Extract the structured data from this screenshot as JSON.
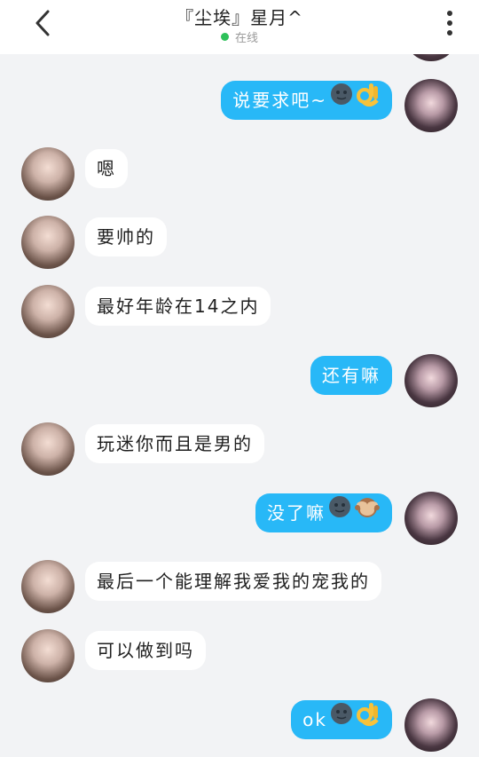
{
  "header": {
    "title": "『尘埃』星月^",
    "status": "在线",
    "status_color": "#2ec15a",
    "back_icon": "chevron-left-icon",
    "menu_icon": "more-vertical-icon"
  },
  "colors": {
    "background": "#f2f3f5",
    "incoming_bubble": "#ffffff",
    "outgoing_bubble": "#28b8f7"
  },
  "messages": [
    {
      "side": "out",
      "text": "说要求吧~",
      "emojis": [
        "new-moon-face-emoji",
        "ok-hand-emoji"
      ]
    },
    {
      "side": "in",
      "text": "嗯"
    },
    {
      "side": "in",
      "text": "要帅的"
    },
    {
      "side": "in",
      "text": "最好年龄在14之内"
    },
    {
      "side": "out",
      "text": "还有嘛"
    },
    {
      "side": "in",
      "text": "玩迷你而且是男的"
    },
    {
      "side": "out",
      "text": "没了嘛",
      "emojis": [
        "new-moon-face-emoji",
        "see-no-evil-monkey-emoji"
      ]
    },
    {
      "side": "in",
      "text": "最后一个能理解我爱我的宠我的"
    },
    {
      "side": "in",
      "text": "可以做到吗"
    },
    {
      "side": "out",
      "text": "ok",
      "emojis": [
        "new-moon-face-emoji",
        "ok-hand-emoji"
      ]
    }
  ]
}
